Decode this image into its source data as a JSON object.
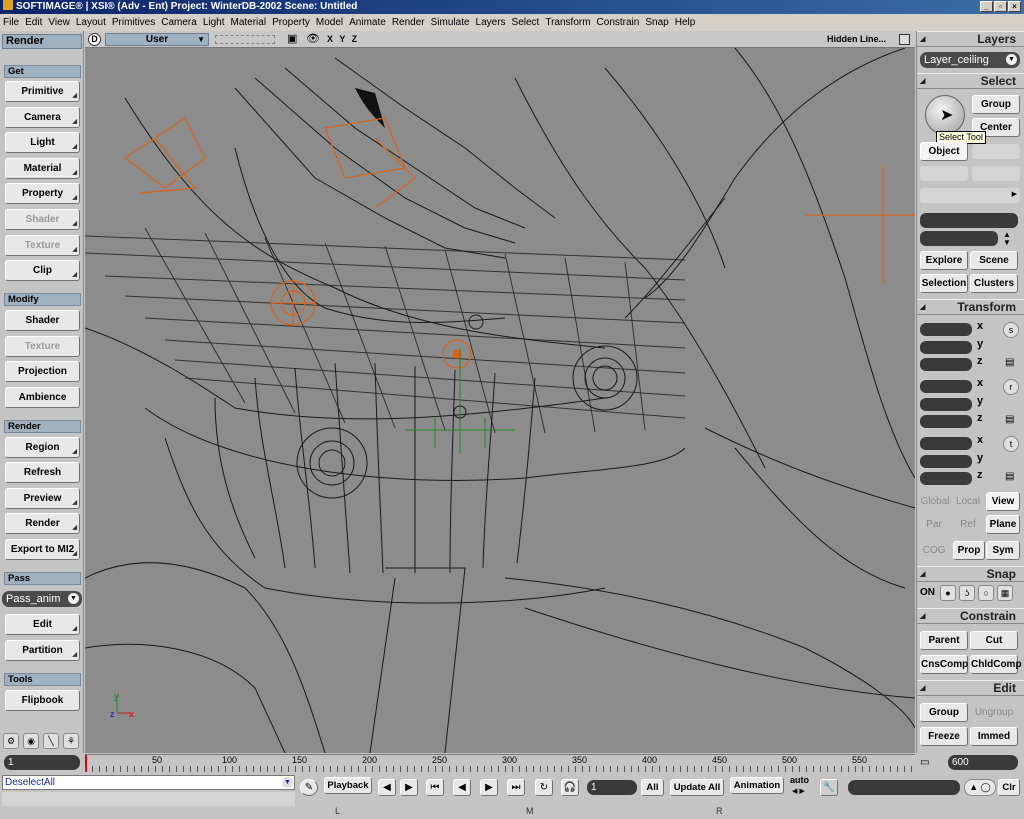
{
  "window": {
    "title": "SOFTIMAGE® | XSI® (Adv - Ent) Project: WinterDB-2002    Scene: Untitled",
    "controls": [
      "_",
      "▫",
      "×"
    ]
  },
  "menubar": [
    "File",
    "Edit",
    "View",
    "Layout",
    "Primitives",
    "Camera",
    "Light",
    "Material",
    "Property",
    "Model",
    "Animate",
    "Render",
    "Simulate",
    "Layers",
    "Select",
    "Transform",
    "Constrain",
    "Snap",
    "Help"
  ],
  "left_panel": {
    "title": "Render",
    "sections": {
      "get": "Get",
      "modify": "Modify",
      "render": "Render",
      "pass": "Pass",
      "tools": "Tools"
    },
    "get_buttons": [
      "Primitive",
      "Camera",
      "Light",
      "Material",
      "Property",
      "Shader",
      "Texture",
      "Clip"
    ],
    "modify_buttons": [
      "Shader",
      "Texture",
      "Projection",
      "Ambience"
    ],
    "render_buttons": [
      "Region",
      "Refresh",
      "Preview",
      "Render",
      "Export to MI2"
    ],
    "pass_dropdown": "Pass_anim",
    "pass_buttons": [
      "Edit",
      "Partition"
    ],
    "tools_buttons": [
      "Flipbook"
    ]
  },
  "viewport": {
    "view_letter": "D",
    "camera_menu": "User",
    "axes": "X Y Z",
    "display_mode": "Hidden Line...",
    "frame": {
      "background": "#8c8c8c",
      "wire": "#1a1a1a",
      "light": "#d8641e",
      "selected": "#1e8c1e"
    }
  },
  "right_panel": {
    "layers_title": "Layers",
    "layer_dropdown": "Layer_ceiling",
    "select_title": "Select",
    "group": "Group",
    "center": "Center",
    "tooltip": "Select Tool",
    "object": "Object",
    "explore": "Explore",
    "scene": "Scene",
    "selection": "Selection",
    "clusters": "Clusters",
    "transform_title": "Transform",
    "axes": [
      "x",
      "y",
      "z"
    ],
    "transform_icons": [
      "s",
      "r",
      "t"
    ],
    "global": "Global",
    "local": "Local",
    "view": "View",
    "par": "Par",
    "ref": "Ref",
    "plane": "Plane",
    "cog": "COG",
    "prop": "Prop",
    "sym": "Sym",
    "snap_title": "Snap",
    "snap_on": "ON",
    "constrain_title": "Constrain",
    "parent": "Parent",
    "cut": "Cut",
    "cnscomp": "CnsComp",
    "chldcomp": "ChldComp",
    "edit_title": "Edit",
    "edit_group": "Group",
    "ungroup": "Ungroup",
    "freeze": "Freeze",
    "immed": "Immed"
  },
  "timeline": {
    "start": "1",
    "end": "600",
    "ticks": [
      "50",
      "100",
      "150",
      "200",
      "250",
      "300",
      "350",
      "400",
      "450",
      "500",
      "550"
    ]
  },
  "bottom_bar": {
    "command": "DeselectAll",
    "playback": "Playback",
    "frame": "1",
    "all": "All",
    "update_all": "Update All",
    "animation": "Animation",
    "auto": "auto",
    "clr": "Clr",
    "mouse": [
      "L",
      "M",
      "R"
    ]
  }
}
